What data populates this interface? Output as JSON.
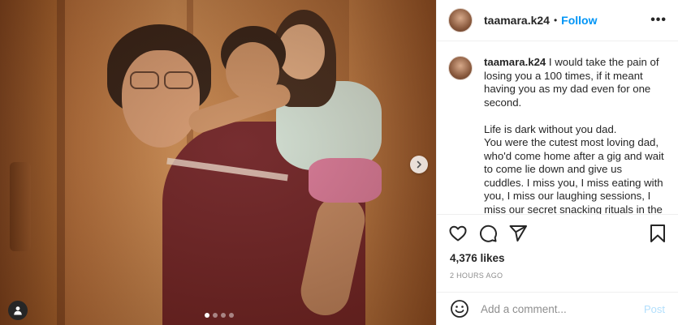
{
  "photo": {
    "carousel_count": 4,
    "carousel_active_index": 0,
    "icons": {
      "next": "chevron-right-icon",
      "tagged": "person-tag-icon"
    }
  },
  "header": {
    "username": "taamara.k24",
    "separator": "•",
    "follow_label": "Follow",
    "more_label": "•••"
  },
  "caption": {
    "username": "taamara.k24",
    "text": " I would take the pain of losing you a 100 times, if it meant having you as my dad even for one second.\n\nLife is dark without you dad.\nYou were the cutest most loving dad, who'd come home after a gig and wait to come lie down and give us cuddles. I miss you, I miss eating with you, I miss our laughing sessions, I miss our secret snacking rituals in the"
  },
  "actions": {
    "icons": [
      "heart-icon",
      "comment-icon",
      "share-icon",
      "bookmark-icon"
    ]
  },
  "likes": "4,376 likes",
  "timestamp": "2 HOURS AGO",
  "comment": {
    "placeholder": "Add a comment...",
    "post_label": "Post",
    "icon": "emoji-icon"
  },
  "colors": {
    "accent": "#0095f6",
    "post_disabled": "#b2dffc",
    "muted": "#8e8e8e",
    "text": "#262626"
  }
}
